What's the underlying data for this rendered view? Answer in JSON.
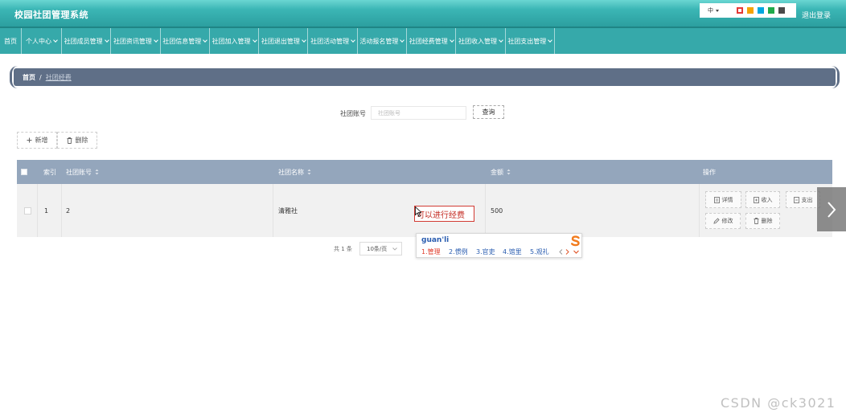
{
  "app": {
    "title": "校园社团管理系统"
  },
  "header": {
    "language_label": "中",
    "theme_colors": [
      "#e53935",
      "#f5a300",
      "#00a6e0",
      "#1faa4b",
      "#4a4a4a"
    ],
    "logout_label": "退出登录"
  },
  "nav": {
    "items": [
      {
        "label": "首页"
      },
      {
        "label": "个人中心"
      },
      {
        "label": "社团成员管理"
      },
      {
        "label": "社团资讯管理"
      },
      {
        "label": "社团信息管理"
      },
      {
        "label": "社团加入管理"
      },
      {
        "label": "社团退出管理"
      },
      {
        "label": "社团活动管理"
      },
      {
        "label": "活动报名管理"
      },
      {
        "label": "社团经费管理"
      },
      {
        "label": "社团收入管理"
      },
      {
        "label": "社团支出管理"
      }
    ]
  },
  "breadcrumb": {
    "home": "首页",
    "separator": "/",
    "current": "社团经费"
  },
  "search": {
    "label": "社团账号",
    "placeholder": "社团账号",
    "button_label": "查询"
  },
  "toolbar": {
    "add_label": "新增",
    "delete_label": "删除"
  },
  "table": {
    "columns": [
      "索引",
      "社团账号",
      "社团名称",
      "金额",
      "操作"
    ],
    "rows": [
      {
        "index": "1",
        "account": "2",
        "name": "清雅社",
        "amount": "500",
        "actions": [
          "详情",
          "收入",
          "支出",
          "修改",
          "删除"
        ]
      }
    ]
  },
  "pagination": {
    "total_text": "共 1 条",
    "page_size": "10条/页"
  },
  "ime": {
    "tooltip": "可以进行经费",
    "pinyin": "guan'li",
    "candidates": [
      "1.管理",
      "2.惯例",
      "3.官吏",
      "4.馆里",
      "5.观礼"
    ]
  },
  "watermark": "CSDN @ck3021",
  "colors": {
    "nav_bg": "#36a9aa",
    "breadcrumb_bg": "#5f6f87",
    "table_header_bg": "#94a6bc",
    "row_bg": "#f1f1f1",
    "ime_selected": "#e03b2a",
    "ime_text": "#2a5db0",
    "ime_logo": "#f27b1c"
  }
}
